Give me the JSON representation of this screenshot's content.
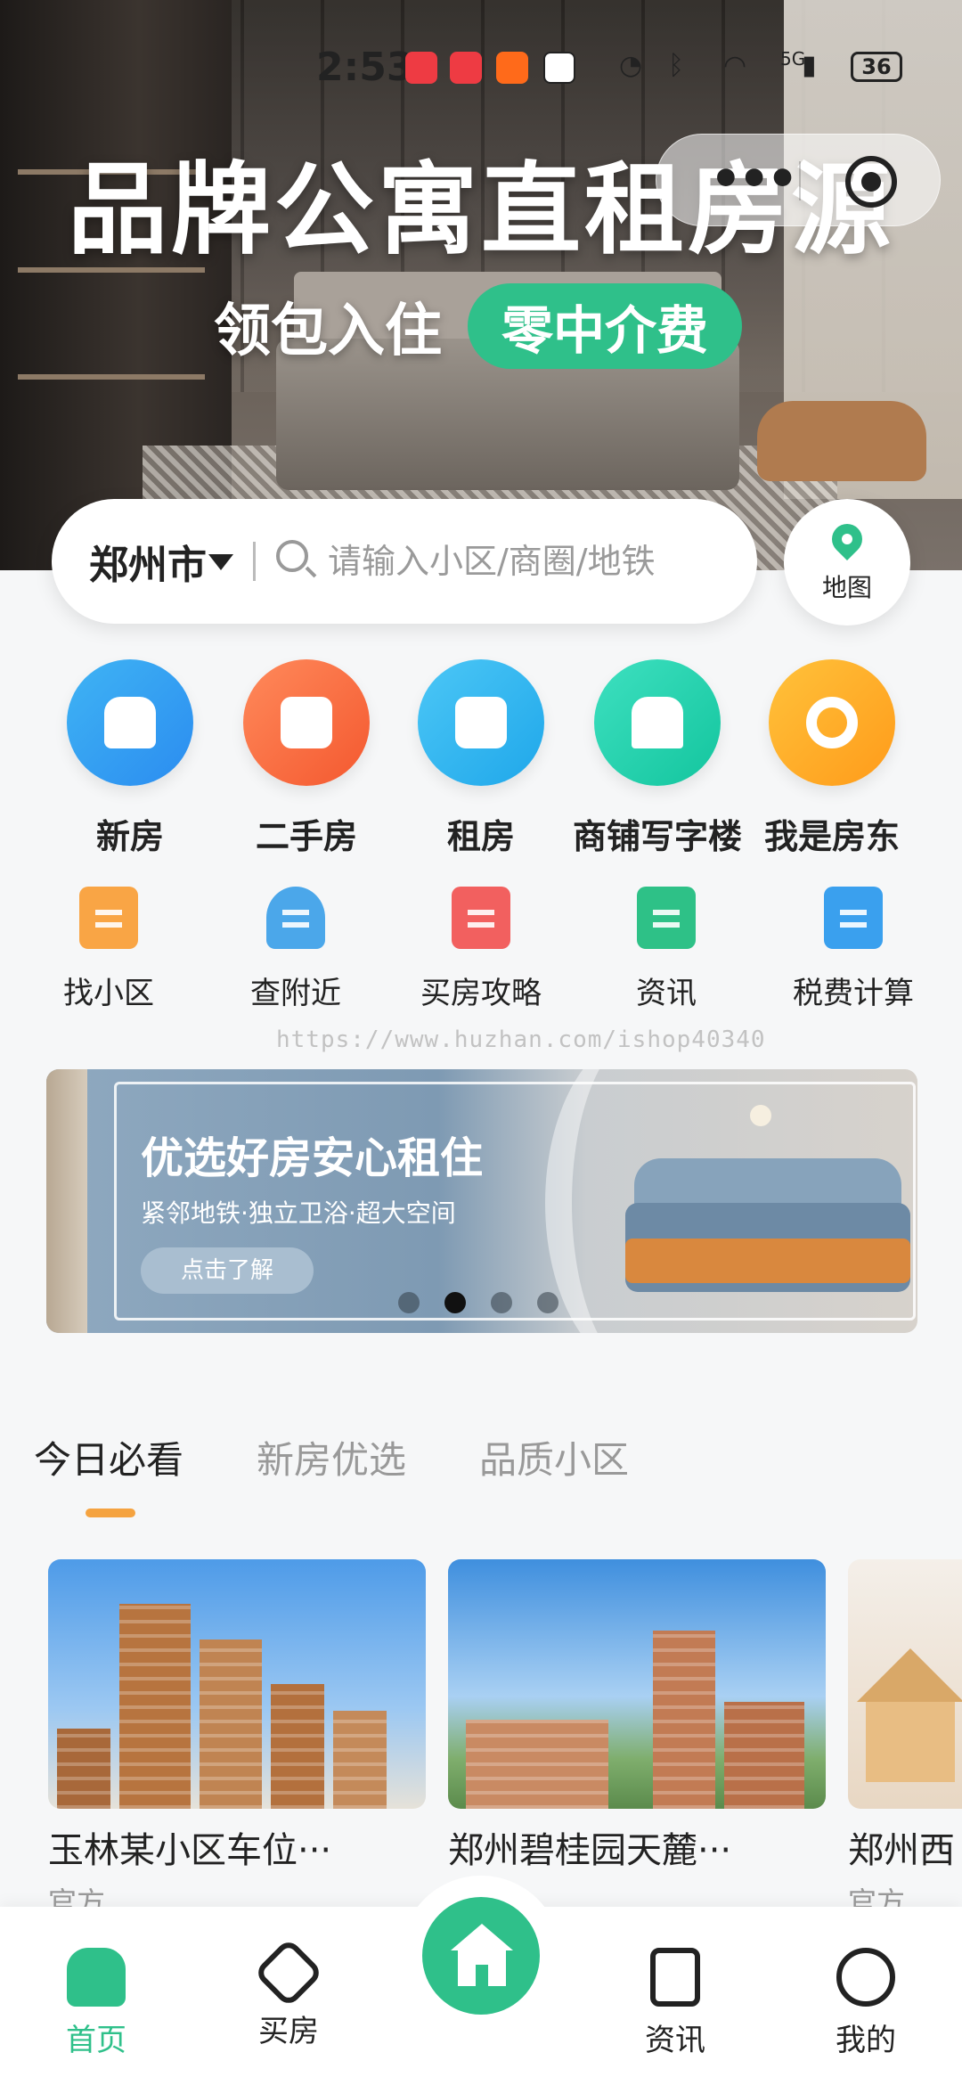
{
  "status_bar": {
    "time": "2:53",
    "battery": "36",
    "network": "5G"
  },
  "hero": {
    "title": "品牌公寓直租房源",
    "subtitle": "领包入住",
    "highlight": "零中介费"
  },
  "search": {
    "city": "郑州市",
    "placeholder": "请输入小区/商圈/地铁",
    "map_label": "地图"
  },
  "main_categories": [
    {
      "label": "新房",
      "icon": "home-icon",
      "color_from": "#3fb4f4",
      "color_to": "#2b8cf0"
    },
    {
      "label": "二手房",
      "icon": "card-icon",
      "color_from": "#ff8a5b",
      "color_to": "#f4582f"
    },
    {
      "label": "租房",
      "icon": "suitcase-icon",
      "color_from": "#4cc7f6",
      "color_to": "#1fa7ea"
    },
    {
      "label": "商铺写字楼",
      "icon": "shop-icon",
      "color_from": "#3ee0c0",
      "color_to": "#13c59e"
    },
    {
      "label": "我是房东",
      "icon": "key-icon",
      "color_from": "#ffc23b",
      "color_to": "#ff9b1a"
    }
  ],
  "sub_categories": [
    {
      "label": "找小区",
      "icon": "building-icon",
      "color": "#f9a545"
    },
    {
      "label": "查附近",
      "icon": "location-icon",
      "color": "#4ba7ea"
    },
    {
      "label": "买房攻略",
      "icon": "book-icon",
      "color": "#f2605f"
    },
    {
      "label": "资讯",
      "icon": "document-icon",
      "color": "#2ec187"
    },
    {
      "label": "税费计算",
      "icon": "calculator-icon",
      "color": "#3aa0ee"
    }
  ],
  "watermark": "https://www.huzhan.com/ishop40340",
  "banner": {
    "title": "优选好房安心租住",
    "subtitle": "紧邻地铁·独立卫浴·超大空间",
    "button": "点击了解",
    "active_dot": 1,
    "dot_count": 4
  },
  "tabs": [
    {
      "label": "今日必看",
      "active": true
    },
    {
      "label": "新房优选",
      "active": false
    },
    {
      "label": "品质小区",
      "active": false
    }
  ],
  "cards": [
    {
      "title": "玉林某小区车位···",
      "tag": "官方"
    },
    {
      "title": "郑州碧桂园天麓···",
      "tag": "官方"
    },
    {
      "title": "郑州西",
      "tag": "官方"
    }
  ],
  "bottom_nav": [
    {
      "label": "首页",
      "icon": "home-icon",
      "active": true
    },
    {
      "label": "买房",
      "icon": "tag-icon",
      "active": false
    },
    {
      "label": "",
      "icon": "house-center-icon",
      "active": false
    },
    {
      "label": "资讯",
      "icon": "news-icon",
      "active": false
    },
    {
      "label": "我的",
      "icon": "profile-icon",
      "active": false
    }
  ],
  "colors": {
    "accent": "#2fc08a",
    "tab_underline": "#f5a340"
  }
}
